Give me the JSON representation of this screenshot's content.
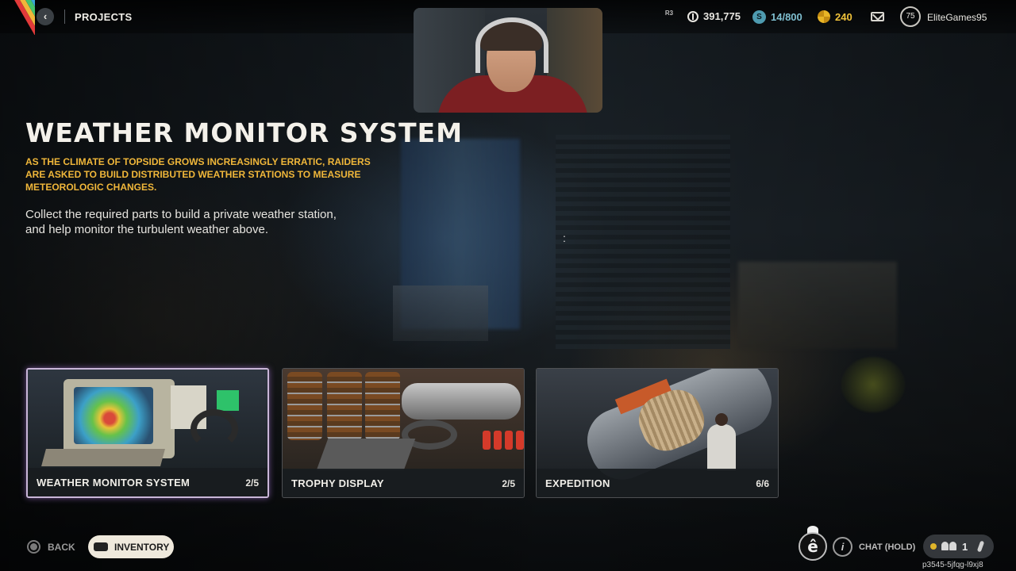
{
  "topbar": {
    "section_label": "PROJECTS",
    "r3_hint": "R3",
    "coins": "391,775",
    "stash": "14/800",
    "gold": "240",
    "player_level": "75",
    "username": "EliteGames95"
  },
  "project": {
    "title": "WEATHER MONITOR SYSTEM",
    "lore": "AS THE CLIMATE OF TOPSIDE GROWS INCREASINGLY ERRATIC, RAIDERS ARE ASKED TO BUILD DISTRIBUTED WEATHER STATIONS TO MEASURE METEOROLOGIC CHANGES.",
    "description": "Collect the required parts to build a private weather station, and help monitor the turbulent weather above."
  },
  "cards": [
    {
      "name": "WEATHER MONITOR SYSTEM",
      "progress": "2/5",
      "selected": true
    },
    {
      "name": "TROPHY DISPLAY",
      "progress": "2/5",
      "selected": false
    },
    {
      "name": "EXPEDITION",
      "progress": "6/6",
      "selected": false
    }
  ],
  "bottombar": {
    "back_label": "BACK",
    "inventory_label": "INVENTORY",
    "chat_label": "CHAT (HOLD)",
    "party_count": "1",
    "session_code": "p3545-5jfqg-l9xj8"
  },
  "colors": {
    "lore_accent": "#f0b73a",
    "selected_glow": "#c9b6d8",
    "stash_blue": "#4e9bb0",
    "gold": "#e9b526"
  },
  "icons": [
    "back-arrow-icon",
    "coin-icon",
    "stash-icon",
    "gold-icon",
    "mail-icon",
    "circle-button-icon",
    "gamepad-icon",
    "info-icon",
    "party-icon",
    "mic-icon"
  ]
}
